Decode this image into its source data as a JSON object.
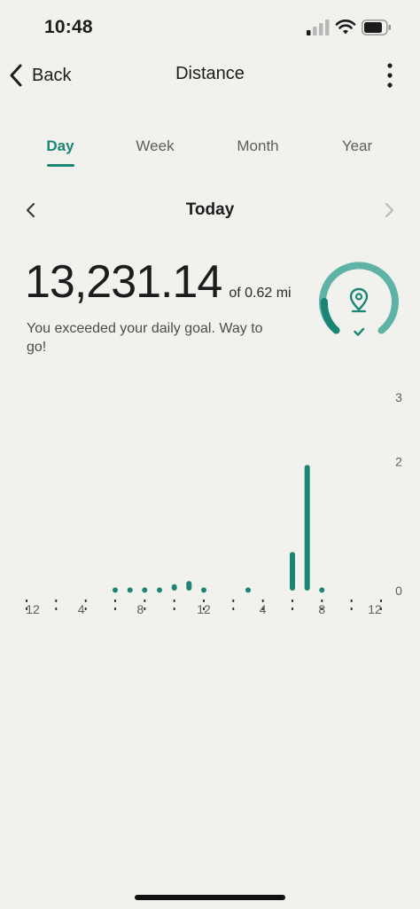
{
  "status_bar": {
    "time": "10:48",
    "icons": [
      "cellular-signal-icon",
      "wifi-icon",
      "battery-icon"
    ]
  },
  "header": {
    "back_label": "Back",
    "title": "Distance",
    "more_icon": "more-vertical-icon"
  },
  "tabs": [
    {
      "label": "Day",
      "active": true
    },
    {
      "label": "Week",
      "active": false
    },
    {
      "label": "Month",
      "active": false
    },
    {
      "label": "Year",
      "active": false
    }
  ],
  "date_nav": {
    "label": "Today",
    "prev_icon": "chevron-left-icon",
    "next_icon": "chevron-right-icon"
  },
  "summary": {
    "value": "13,231.14",
    "goal_text": "of 0.62 mi",
    "message": "You exceeded your daily goal. Way to go!",
    "goal_icon": "location-pin-icon",
    "check_icon": "check-icon"
  },
  "colors": {
    "accent": "#1a8574",
    "ring_light": "#5fb2a6",
    "background": "#f1f2ee",
    "text": "#1c1c1c"
  },
  "chart_data": {
    "type": "bar",
    "x": [
      6,
      7,
      8,
      9,
      10,
      11,
      12,
      15,
      18,
      19,
      20
    ],
    "values": [
      0.05,
      0.05,
      0.05,
      0.05,
      0.1,
      0.15,
      0.05,
      0.05,
      0.6,
      1.95,
      0.05
    ],
    "xlim": [
      0,
      24
    ],
    "ylim": [
      0,
      3
    ],
    "yticks": [
      "0",
      "2",
      "3"
    ],
    "yticks_values": [
      0,
      2,
      3
    ],
    "xtick_labels": [
      "12",
      "4",
      "8",
      "12",
      "4",
      "8",
      "12"
    ],
    "xtick_label_hours": [
      0,
      4,
      8,
      12,
      16,
      20,
      24
    ],
    "grid": false,
    "xlabel": "",
    "ylabel": ""
  }
}
